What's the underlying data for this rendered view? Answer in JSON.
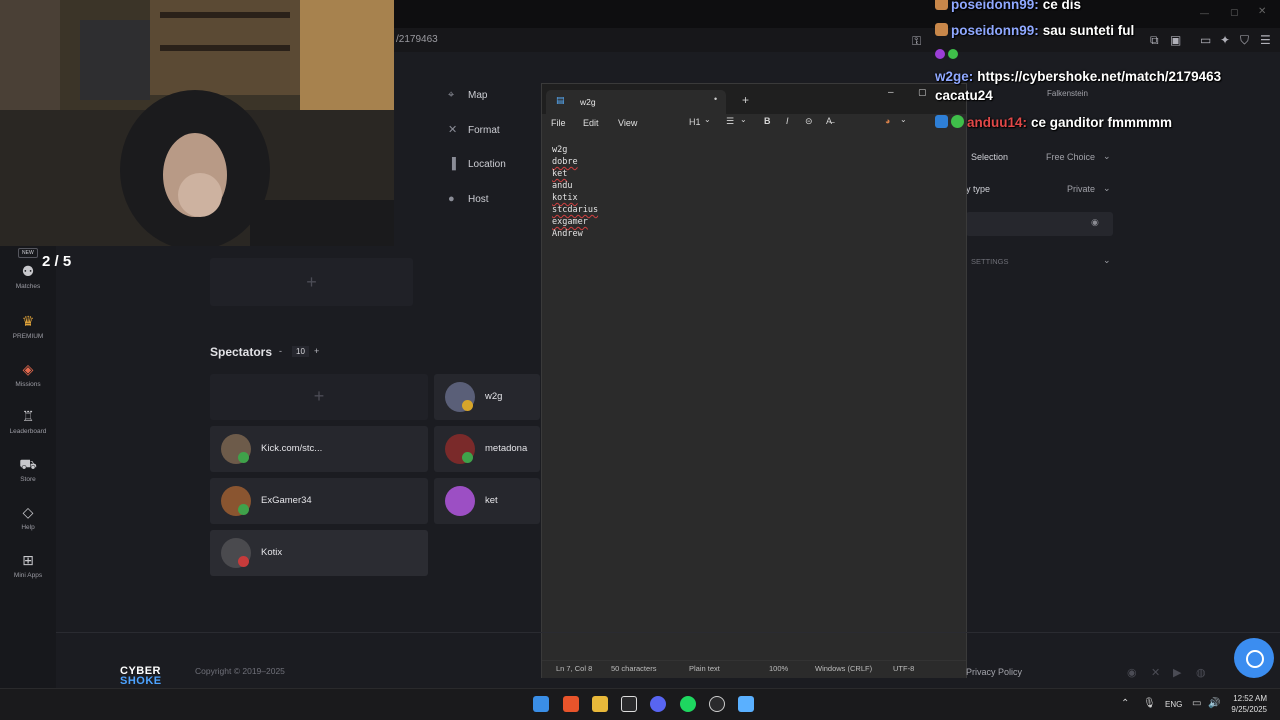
{
  "browser": {
    "url": "/2179463"
  },
  "stream": {
    "score": "2  / 5"
  },
  "leftnav": {
    "new_badge": "NEW",
    "items": [
      {
        "label": "Matches",
        "icon": "matches-icon"
      },
      {
        "label": "PREMIUM",
        "icon": "crown-icon"
      },
      {
        "label": "Missions",
        "icon": "missions-icon"
      },
      {
        "label": "Leaderboard",
        "icon": "trophy-icon"
      },
      {
        "label": "Store",
        "icon": "cart-icon"
      },
      {
        "label": "Help",
        "icon": "help-icon"
      },
      {
        "label": "Mini Apps",
        "icon": "grid-icon"
      }
    ]
  },
  "dropdown": {
    "items": [
      {
        "label": "Map"
      },
      {
        "label": "Format"
      },
      {
        "label": "Location"
      },
      {
        "label": "Host"
      }
    ]
  },
  "spectators": {
    "title": "Spectators",
    "minus": "-",
    "count": "10",
    "plus": "+",
    "players": [
      {
        "name": "w2g",
        "badge_color": "#d7a52a",
        "avatar_color": "#5a5f78"
      },
      {
        "name": "Kick.com/stc...",
        "badge_color": "#3fa24a",
        "avatar_color": "#6d5b4a"
      },
      {
        "name": "metadona",
        "badge_color": "#3fa24a",
        "avatar_color": "#7a2a2a"
      },
      {
        "name": "ExGamer34",
        "badge_color": "#3fa24a",
        "avatar_color": "#8a5530"
      },
      {
        "name": "ket",
        "badge_color": "#9c5cd6",
        "avatar_color": "#9c4fc4"
      },
      {
        "name": "Kotix",
        "badge_color": "#c63b3b",
        "avatar_color": "#4a4a4e"
      }
    ]
  },
  "settings": {
    "location_value": "Falkenstein",
    "selection_label": "Selection",
    "selection_value": "Free Choice",
    "type_label": "y type",
    "type_value": "Private",
    "section_label": "SETTINGS"
  },
  "notepad": {
    "tab_title": "w2g",
    "menu": [
      "File",
      "Edit",
      "View"
    ],
    "heading_select": "H1",
    "lines": [
      "w2g",
      "dobre",
      "ket",
      "andu",
      "kotix",
      "stcdarius",
      "exgamer",
      "Andrew"
    ],
    "status": {
      "position": "Ln 7, Col 8",
      "chars": "50 characters",
      "format": "Plain text",
      "zoom": "100%",
      "line_ending": "Windows (CRLF)",
      "encoding": "UTF-8"
    }
  },
  "chat": [
    {
      "user": "poseidonn99:",
      "text": "ce dis",
      "color": "#8fa8ff"
    },
    {
      "user": "poseidonn99:",
      "text": "sau sunteti ful",
      "color": "#8fa8ff"
    },
    {
      "user": "w2ge:",
      "text": "https://cybershoke.net/match/2179463",
      "color": "#8fa8ff"
    },
    {
      "user": "",
      "text": "cacatu24",
      "color": "#ffffff"
    },
    {
      "user": "anduu14:",
      "text": "ce ganditor fmmmmm",
      "color": "#e04848"
    }
  ],
  "footer": {
    "logo_top": "CYBER",
    "logo_bottom": "SHOKE",
    "copyright": "Copyright © 2019–2025",
    "privacy": "Privacy Policy"
  },
  "taskbar": {
    "lang": "ENG",
    "time": "12:52 AM",
    "date": "9/25/2025"
  }
}
